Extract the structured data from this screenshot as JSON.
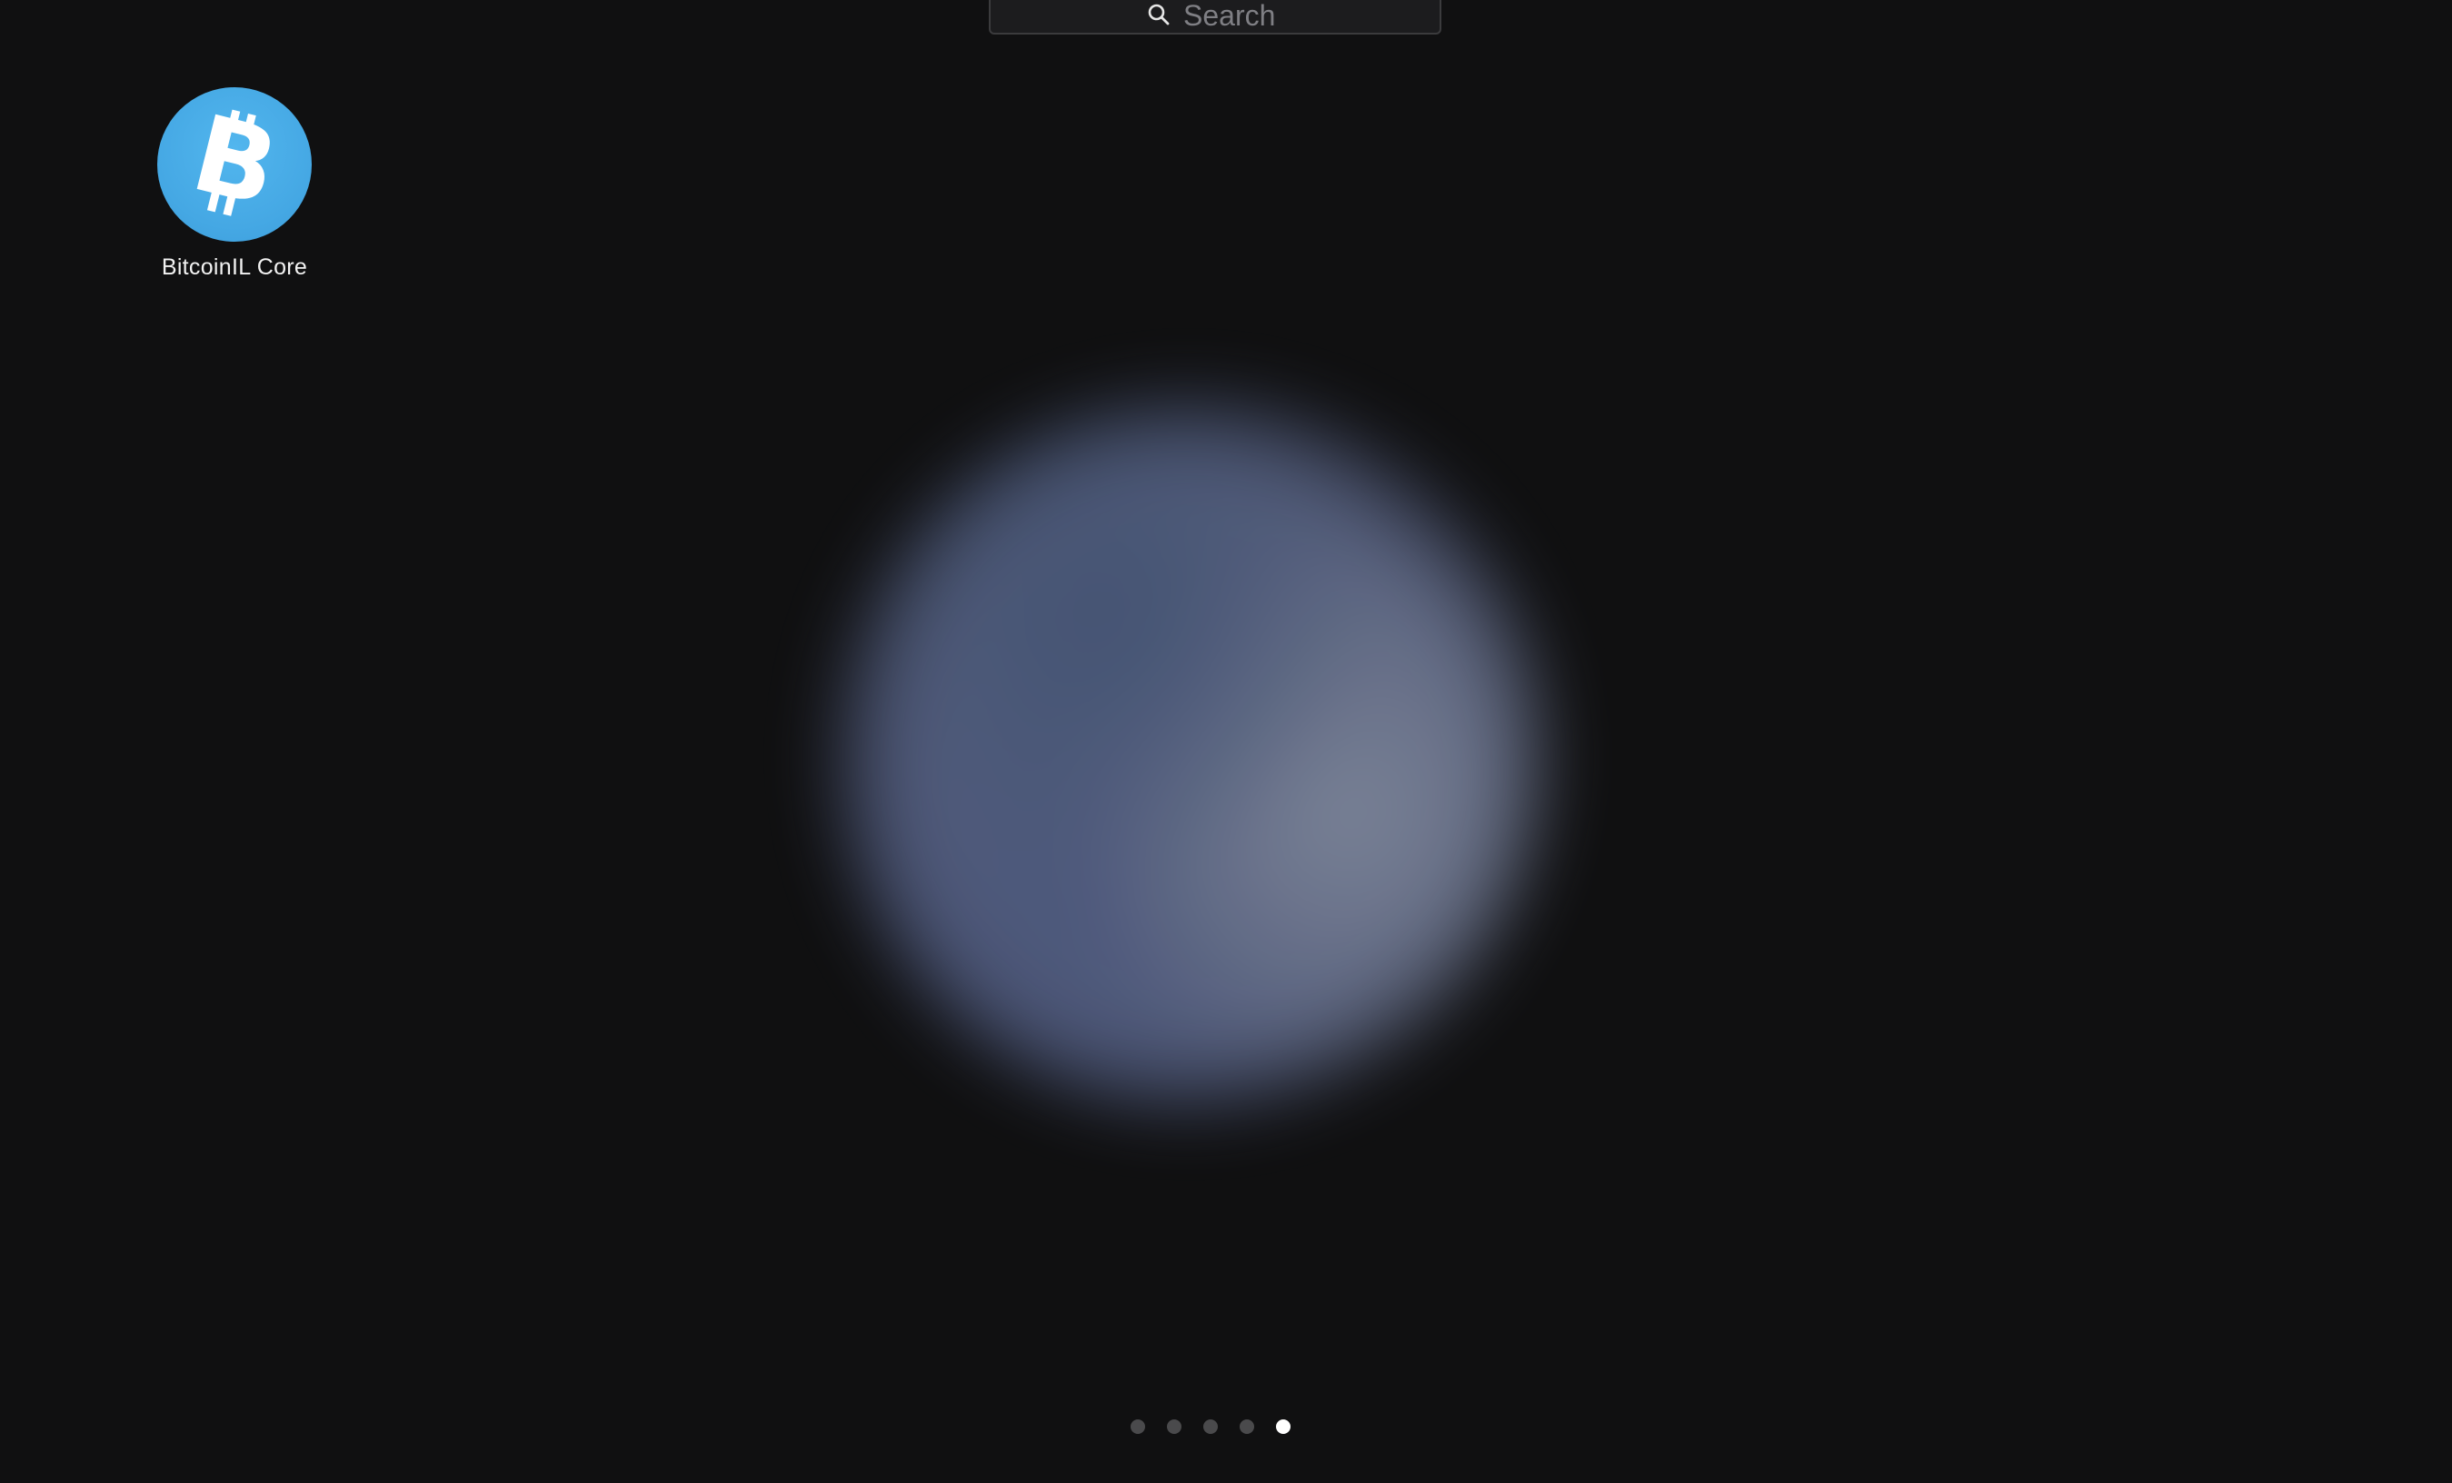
{
  "search": {
    "placeholder": "Search",
    "icon": "search-icon"
  },
  "apps": [
    {
      "label": "BitcoinIL Core",
      "icon": "bitcoin-icon",
      "icon_color": "#45a8e4"
    }
  ],
  "pagination": {
    "total_pages": 5,
    "current_page": 5
  },
  "colors": {
    "background": "#101011",
    "dot_inactive": "#4a4a4c",
    "dot_active": "#ffffff"
  }
}
